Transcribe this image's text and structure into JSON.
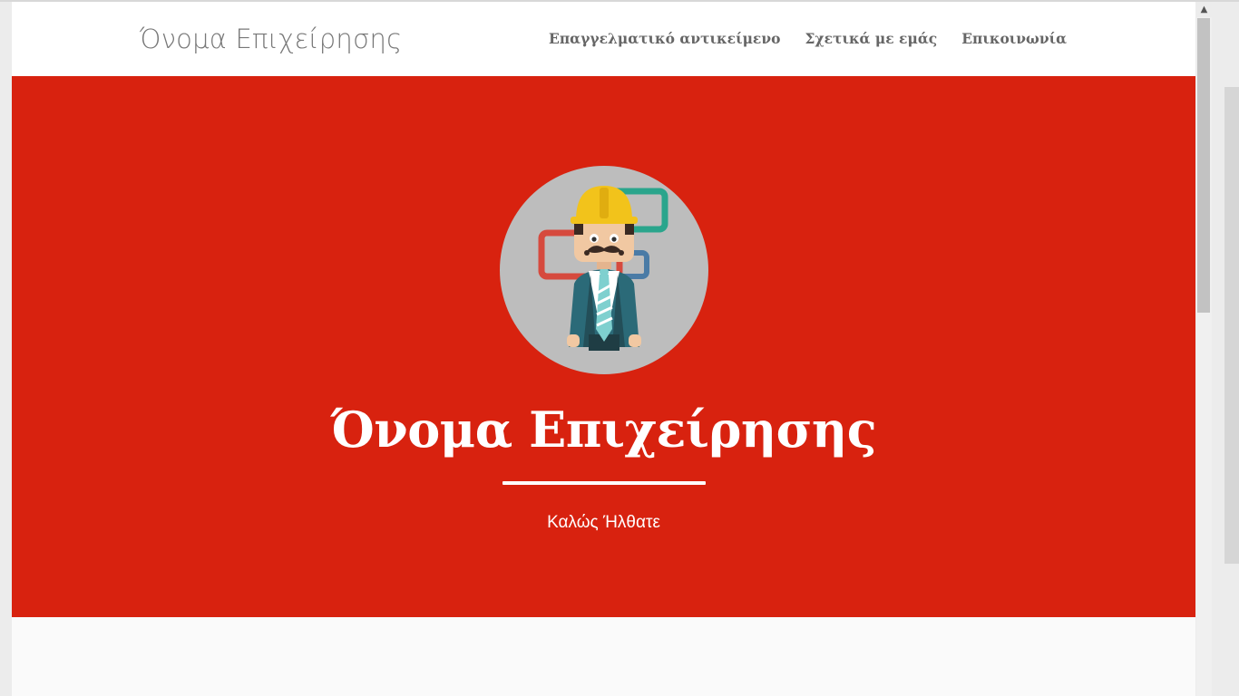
{
  "navbar": {
    "brand": "Όνομα Επιχείρησης",
    "links": [
      {
        "label": "Επαγγελματικό αντικείμενο"
      },
      {
        "label": "Σχετικά με εμάς"
      },
      {
        "label": "Επικοινωνία"
      }
    ]
  },
  "hero": {
    "title": "Όνομα Επιχείρησης",
    "subtitle": "Καλώς Ήλθατε",
    "icon": "construction-worker-avatar"
  },
  "colors": {
    "hero_background": "#d8220f",
    "navbar_background": "#ffffff",
    "page_background": "#fafafa"
  },
  "scrollbar": {
    "up_arrow": "▲"
  }
}
